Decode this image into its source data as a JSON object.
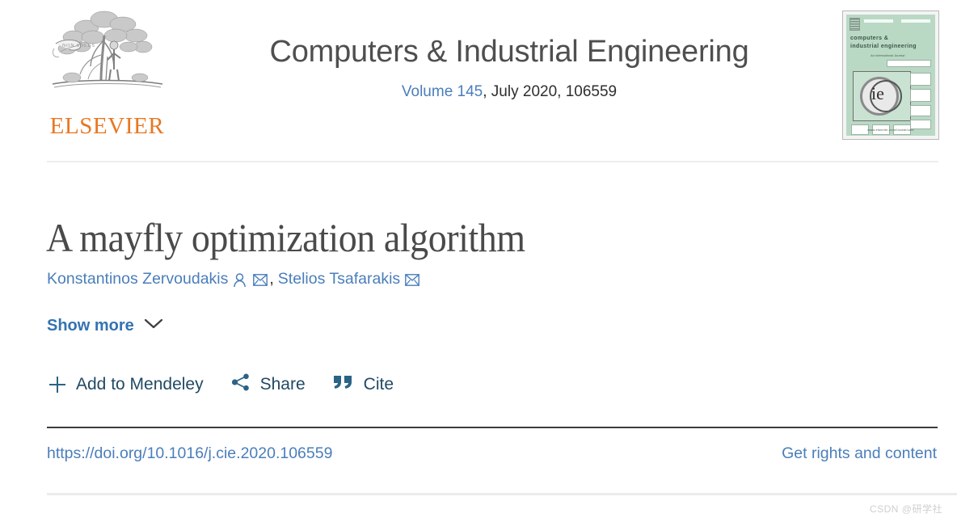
{
  "publisher": {
    "name": "ELSEVIER",
    "logo_icon": "elsevier-tree-logo",
    "motto": "NON SOLUS",
    "brand_color": "#E87722"
  },
  "journal": {
    "title": "Computers & Industrial Engineering",
    "volume_link": "Volume 145",
    "issue_info": ", July 2020, 106559",
    "cover": {
      "title_line1": "computers &",
      "title_line2": "industrial engineering",
      "subtitle": "An International Journal",
      "logo_text": "ie",
      "footer": "www.elsevier.com/locate/caie",
      "background_color": "#b9d9c4"
    }
  },
  "article": {
    "title": "A mayfly optimization algorithm",
    "authors": [
      {
        "name": "Konstantinos Zervoudakis",
        "icons": [
          "person-icon",
          "envelope-icon"
        ]
      },
      {
        "name": "Stelios Tsafarakis",
        "icons": [
          "envelope-icon"
        ]
      }
    ],
    "author_separator": ", ",
    "show_more_label": "Show more",
    "show_more_icon": "chevron-down-icon"
  },
  "actions": [
    {
      "label": "Add to Mendeley",
      "icon": "plus-icon"
    },
    {
      "label": "Share",
      "icon": "share-nodes-icon"
    },
    {
      "label": "Cite",
      "icon": "quote-marks-icon"
    }
  ],
  "links": {
    "doi": "https://doi.org/10.1016/j.cie.2020.106559",
    "rights": "Get rights and content"
  },
  "watermark": "CSDN @研学社",
  "colors": {
    "link_blue": "#4a7ebb",
    "show_more_blue": "#3573b1",
    "action_navy": "#214a63",
    "title_gray": "#4a4a4a"
  }
}
